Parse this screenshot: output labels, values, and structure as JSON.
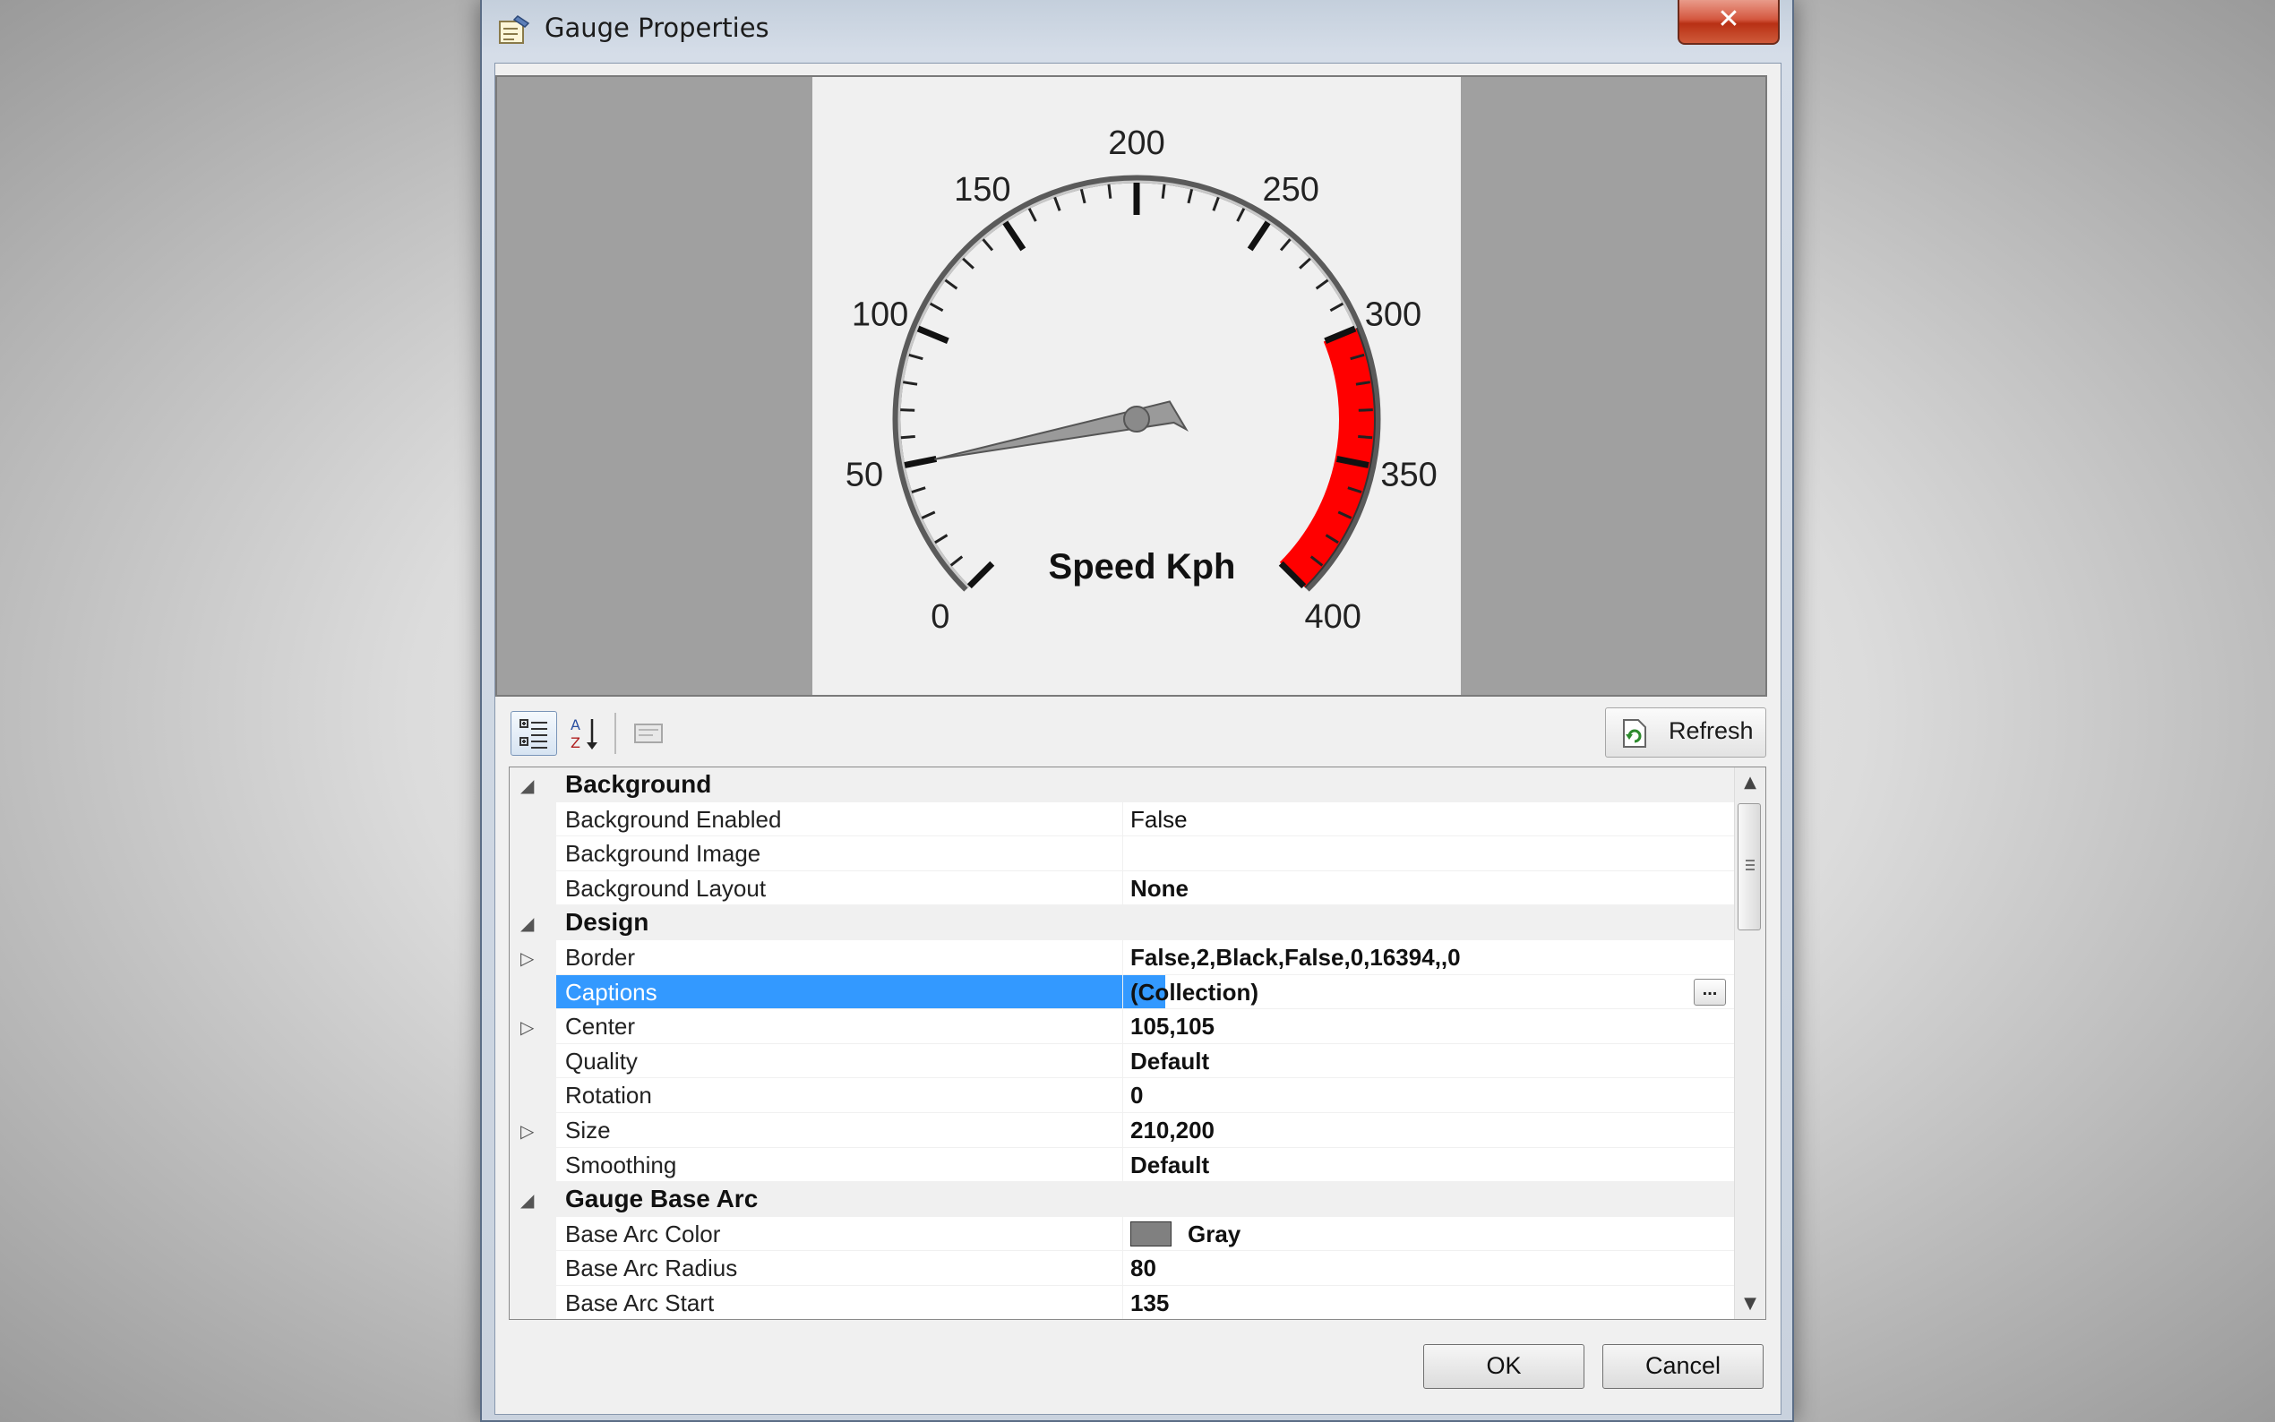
{
  "window": {
    "title": "Gauge Properties",
    "close_label": "✕"
  },
  "gauge": {
    "caption": "Speed Kph",
    "min": 0,
    "max": 400,
    "start_angle_deg": 135,
    "sweep_deg": 270,
    "major_labels": [
      "0",
      "50",
      "100",
      "150",
      "200",
      "250",
      "300",
      "350",
      "400"
    ],
    "red_zone": [
      300,
      400
    ],
    "needle_value": 50,
    "arc_color": "#808080",
    "red_color": "#ff0000"
  },
  "toolbar": {
    "refresh_label": "Refresh"
  },
  "grid": {
    "rows": [
      {
        "type": "cat",
        "name": "Background"
      },
      {
        "type": "prop",
        "name": "Background Enabled",
        "value": "False",
        "bold": false
      },
      {
        "type": "prop",
        "name": "Background Image",
        "value": "",
        "bold": false
      },
      {
        "type": "prop",
        "name": "Background Layout",
        "value": "None",
        "bold": true
      },
      {
        "type": "cat",
        "name": "Design"
      },
      {
        "type": "prop",
        "name": "Border",
        "value": "False,2,Black,False,0,16394,,0",
        "bold": true,
        "expandable": true
      },
      {
        "type": "prop",
        "name": "Captions",
        "value": "(Collection)",
        "bold": true,
        "selected": true,
        "ellipsis": "..."
      },
      {
        "type": "prop",
        "name": "Center",
        "value": "105,105",
        "bold": true,
        "expandable": true
      },
      {
        "type": "prop",
        "name": "Quality",
        "value": "Default",
        "bold": true
      },
      {
        "type": "prop",
        "name": "Rotation",
        "value": "0",
        "bold": true
      },
      {
        "type": "prop",
        "name": "Size",
        "value": "210,200",
        "bold": true,
        "expandable": true
      },
      {
        "type": "prop",
        "name": "Smoothing",
        "value": "Default",
        "bold": true
      },
      {
        "type": "cat",
        "name": "Gauge Base Arc"
      },
      {
        "type": "prop",
        "name": "Base Arc Color",
        "value": "Gray",
        "bold": true,
        "swatch": "#808080"
      },
      {
        "type": "prop",
        "name": "Base Arc Radius",
        "value": "80",
        "bold": true
      },
      {
        "type": "prop",
        "name": "Base Arc Start",
        "value": "135",
        "bold": true
      }
    ]
  },
  "buttons": {
    "ok": "OK",
    "cancel": "Cancel"
  }
}
